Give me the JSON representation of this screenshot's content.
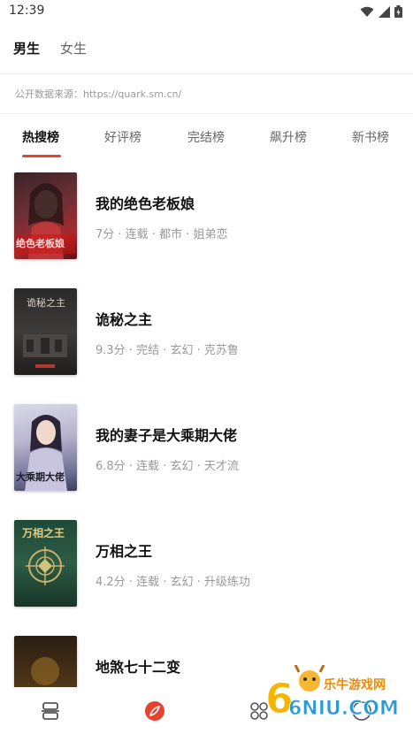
{
  "status_bar": {
    "time": "12:39"
  },
  "gender_tabs": [
    {
      "label": "男生",
      "active": true
    },
    {
      "label": "女生",
      "active": false
    }
  ],
  "source_note": "公开数据来源：https://quark.sm.cn/",
  "rank_tabs": [
    {
      "label": "热搜榜",
      "active": true
    },
    {
      "label": "好评榜",
      "active": false
    },
    {
      "label": "完结榜",
      "active": false
    },
    {
      "label": "飙升榜",
      "active": false
    },
    {
      "label": "新书榜",
      "active": false
    }
  ],
  "books": [
    {
      "title": "我的绝色老板娘",
      "meta": "7分 · 连载 · 都市 · 姐弟恋",
      "cover_text": "绝色老板娘"
    },
    {
      "title": "诡秘之主",
      "meta": "9.3分 · 完结 · 玄幻 · 克苏鲁",
      "cover_text": "诡秘之主"
    },
    {
      "title": "我的妻子是大乘期大佬",
      "meta": "6.8分 · 连载 · 玄幻 · 天才流",
      "cover_text": "大乘期大佬"
    },
    {
      "title": "万相之王",
      "meta": "4.2分 · 连载 · 玄幻 · 升级练功",
      "cover_text": "万相之王"
    },
    {
      "title": "地煞七十二变",
      "meta": "",
      "cover_text": ""
    }
  ],
  "watermark": {
    "text": "乐牛游戏网",
    "logo_text": "6NIU.COM"
  },
  "colors": {
    "accent": "#e8412c",
    "text_primary": "#111111",
    "text_secondary": "#999999"
  },
  "icons": {
    "wifi": "wifi-icon",
    "signal": "signal-icon",
    "battery": "battery-icon",
    "nav": [
      "bookshelf-icon",
      "discover-icon",
      "category-icon",
      "profile-icon"
    ]
  }
}
